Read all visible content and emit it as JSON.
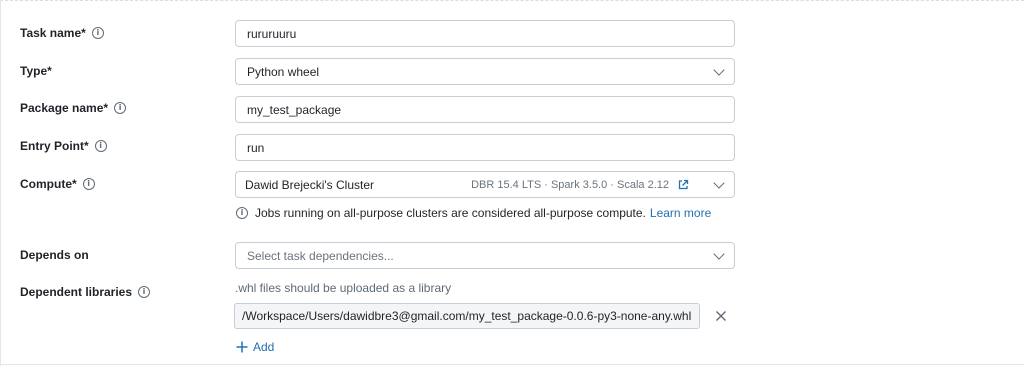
{
  "fields": {
    "task_name": {
      "label": "Task name*",
      "value": "rururuuru"
    },
    "type": {
      "label": "Type*",
      "value": "Python wheel"
    },
    "package_name": {
      "label": "Package name*",
      "value": "my_test_package"
    },
    "entry_point": {
      "label": "Entry Point*",
      "value": "run"
    },
    "compute": {
      "label": "Compute*",
      "value": "Dawid Brejecki's Cluster",
      "meta": "DBR 15.4 LTS · Spark 3.5.0 · Scala 2.12",
      "hint": "Jobs running on all-purpose clusters are considered all-purpose compute.",
      "hint_link": "Learn more"
    },
    "depends_on": {
      "label": "Depends on",
      "placeholder": "Select task dependencies..."
    },
    "dependent_libraries": {
      "label": "Dependent libraries",
      "note": ".whl files should be uploaded as a library",
      "library_path": "/Workspace/Users/dawidbre3@gmail.com/my_test_package-0.0.6-py3-none-any.whl",
      "add_label": "Add"
    }
  },
  "icons": {
    "info": "info-icon",
    "chevron": "chevron-down-icon",
    "external": "external-link-icon",
    "close": "close-icon",
    "plus": "plus-icon"
  },
  "colors": {
    "link": "#2272b4",
    "border": "#c9ced4",
    "muted": "#6a737d"
  }
}
